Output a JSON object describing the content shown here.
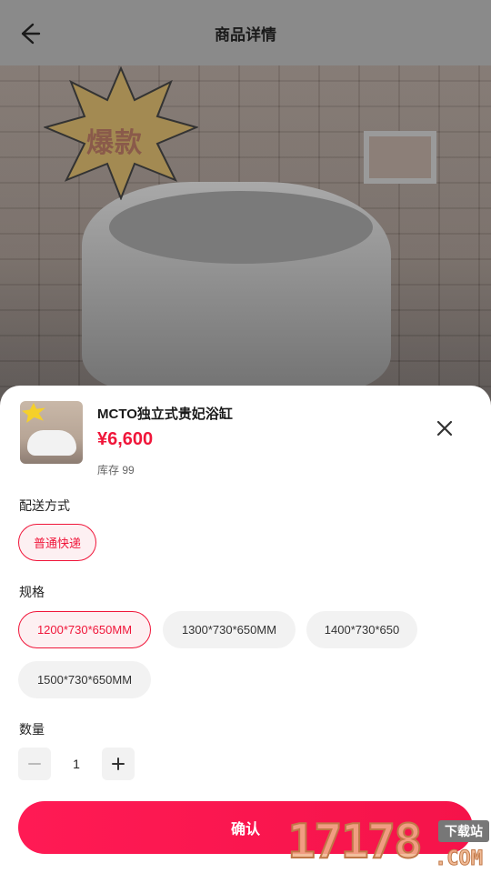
{
  "header": {
    "title": "商品详情",
    "back_icon": "arrow-left-icon"
  },
  "hero": {
    "badge_text": "爆款"
  },
  "product": {
    "name": "MCTO独立式贵妃浴缸",
    "price": "¥6,600",
    "stock": "库存 99"
  },
  "delivery": {
    "label": "配送方式",
    "options": [
      {
        "label": "普通快递",
        "selected": true
      }
    ]
  },
  "specs": {
    "label": "规格",
    "options": [
      {
        "label": "1200*730*650MM",
        "selected": true
      },
      {
        "label": "1300*730*650MM",
        "selected": false
      },
      {
        "label": "1400*730*650",
        "selected": false
      },
      {
        "label": "1500*730*650MM",
        "selected": false
      }
    ]
  },
  "quantity": {
    "label": "数量",
    "value": "1"
  },
  "confirm_label": "确认",
  "watermark": {
    "number": "17178",
    "tag": "下载站",
    "suffix": ".COM"
  },
  "colors": {
    "accent": "#f0163a",
    "button": "#ff1a54"
  }
}
